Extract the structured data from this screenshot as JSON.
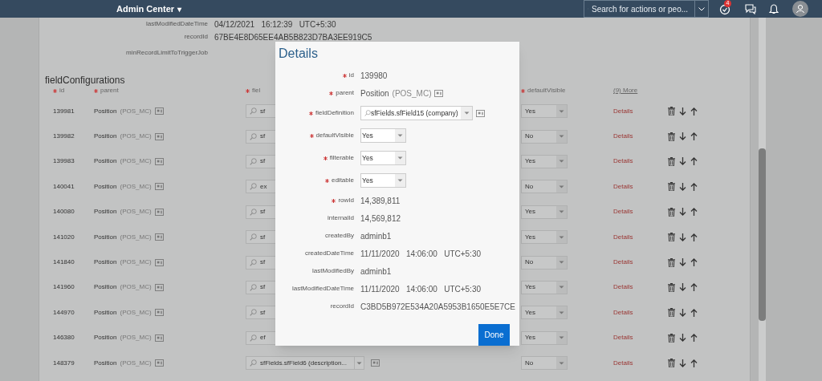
{
  "shell": {
    "title": "Admin Center",
    "caret": "▾",
    "search": {
      "placeholder": "Search for actions or peo..."
    },
    "notification_count": "4"
  },
  "record": [
    {
      "label": "lastModifiedDateTime",
      "value": "04/12/2021   16:12:39   UTC+5:30"
    },
    {
      "label": "recordId",
      "value": "67BE4E8D65EE4AB5B823D7BA3EE919C5"
    },
    {
      "label": "minRecordLimitToTriggerJob"
    }
  ],
  "section_title": "fieldConfigurations",
  "table": {
    "columns": [
      {
        "label": "id",
        "required": true
      },
      {
        "label": "parent",
        "required": true
      },
      {
        "label": "fiel",
        "required": true
      },
      {
        "label": "defaultVisible",
        "required": true
      },
      {
        "label": "(9) More",
        "required": false
      }
    ],
    "rows": [
      {
        "id": "139981",
        "parent": "Position",
        "parent_code": "(POS_MC)",
        "field": "sf",
        "default": "Yes",
        "link": "Details"
      },
      {
        "id": "139982",
        "parent": "Position",
        "parent_code": "(POS_MC)",
        "field": "sf",
        "default": "No",
        "link": "Details"
      },
      {
        "id": "139983",
        "parent": "Position",
        "parent_code": "(POS_MC)",
        "field": "sf",
        "default": "Yes",
        "link": "Details"
      },
      {
        "id": "140041",
        "parent": "Position",
        "parent_code": "(POS_MC)",
        "field": "ex",
        "default": "No",
        "link": "Details"
      },
      {
        "id": "140080",
        "parent": "Position",
        "parent_code": "(POS_MC)",
        "field": "sf",
        "default": "Yes",
        "link": "Details"
      },
      {
        "id": "141020",
        "parent": "Position",
        "parent_code": "(POS_MC)",
        "field": "sf",
        "default": "Yes",
        "link": "Details"
      },
      {
        "id": "141840",
        "parent": "Position",
        "parent_code": "(POS_MC)",
        "field": "sf",
        "default": "No",
        "link": "Details"
      },
      {
        "id": "141960",
        "parent": "Position",
        "parent_code": "(POS_MC)",
        "field": "sf",
        "default": "Yes",
        "link": "Details"
      },
      {
        "id": "144970",
        "parent": "Position",
        "parent_code": "(POS_MC)",
        "field": "sf",
        "default": "Yes",
        "link": "Details"
      },
      {
        "id": "146380",
        "parent": "Position",
        "parent_code": "(POS_MC)",
        "field": "ef",
        "default": "Yes",
        "link": "Details"
      },
      {
        "id": "148379",
        "parent": "Position",
        "parent_code": "(POS_MC)",
        "field": "sfFields.sfField6 (description...",
        "default": "No",
        "link": "Details"
      }
    ]
  },
  "dialog": {
    "title": "Details",
    "fields": [
      {
        "kind": "text",
        "label": "id",
        "required": true,
        "value": "139980"
      },
      {
        "kind": "lookup",
        "label": "parent",
        "required": true,
        "value": "Position",
        "code": "(POS_MC)"
      },
      {
        "kind": "combo",
        "label": "fieldDefinition",
        "required": true,
        "value": "sfFields.sfField15 (company)"
      },
      {
        "kind": "select",
        "label": "defaultVisible",
        "required": true,
        "value": "Yes"
      },
      {
        "kind": "select",
        "label": "filterable",
        "required": true,
        "value": "Yes"
      },
      {
        "kind": "select",
        "label": "editable",
        "required": true,
        "value": "Yes"
      },
      {
        "kind": "text",
        "label": "rowId",
        "required": true,
        "value": "14,389,811"
      },
      {
        "kind": "text",
        "label": "internalId",
        "required": false,
        "value": "14,569,812"
      },
      {
        "kind": "text",
        "label": "createdBy",
        "required": false,
        "value": "adminb1"
      },
      {
        "kind": "text",
        "label": "createdDateTime",
        "required": false,
        "value": "11/11/2020   14:06:00   UTC+5:30"
      },
      {
        "kind": "text",
        "label": "lastModifiedBy",
        "required": false,
        "value": "adminb1"
      },
      {
        "kind": "text",
        "label": "lastModifiedDateTime",
        "required": false,
        "value": "11/11/2020   14:06:00   UTC+5:30"
      },
      {
        "kind": "text",
        "label": "recordId",
        "required": false,
        "value": "C3BD5B972E534A20A5953B1650E5E7CE"
      }
    ],
    "button": "Done"
  }
}
